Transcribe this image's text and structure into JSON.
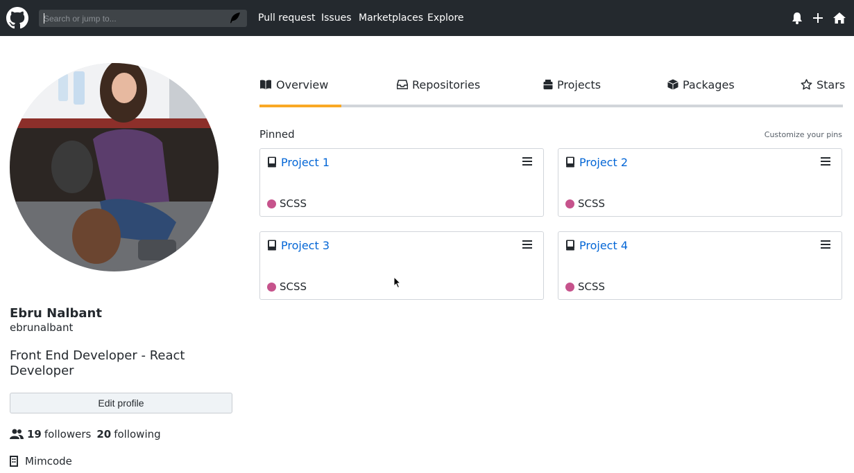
{
  "header": {
    "search_placeholder": "Search or jump to...",
    "nav": [
      "Pull request",
      "Issues",
      "Marketplaces",
      "Explore"
    ]
  },
  "profile": {
    "name": "Ebru Nalbant",
    "login": "ebrunalbant",
    "bio": "Front End Developer - React Developer",
    "edit_label": "Edit profile",
    "followers_count": "19",
    "followers_label": "followers",
    "following_count": "20",
    "following_label": "following",
    "organization": "Mimcode"
  },
  "tabs": [
    {
      "label": "Overview",
      "icon": "book-icon",
      "active": true
    },
    {
      "label": "Repositories",
      "icon": "repo-inbox-icon",
      "active": false
    },
    {
      "label": "Projects",
      "icon": "project-icon",
      "active": false
    },
    {
      "label": "Packages",
      "icon": "package-icon",
      "active": false
    },
    {
      "label": "Stars",
      "icon": "star-icon",
      "active": false
    }
  ],
  "pinned": {
    "title": "Pinned",
    "customize_label": "Customize your pins",
    "cards": [
      {
        "name": "Project 1",
        "language": "SCSS"
      },
      {
        "name": "Project 2",
        "language": "SCSS"
      },
      {
        "name": "Project 3",
        "language": "SCSS"
      },
      {
        "name": "Project 4",
        "language": "SCSS"
      }
    ]
  },
  "colors": {
    "header_bg": "#24292e",
    "tab_active": "#f9a825",
    "link": "#0366d6",
    "scss": "#c6538c"
  }
}
